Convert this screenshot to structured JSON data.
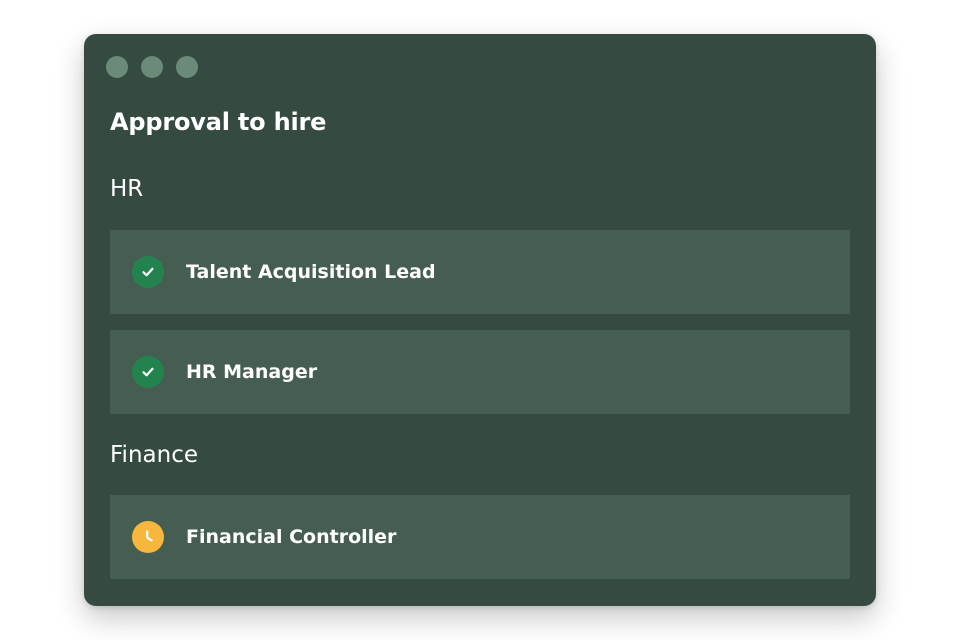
{
  "window": {
    "title": "Approval to hire"
  },
  "sections": [
    {
      "label": "HR",
      "items": [
        {
          "label": "Talent Acquisition Lead",
          "status": "approved",
          "icon": "check-circle-icon"
        },
        {
          "label": "HR Manager",
          "status": "approved",
          "icon": "check-circle-icon"
        }
      ]
    },
    {
      "label": "Finance",
      "items": [
        {
          "label": "Financial Controller",
          "status": "pending",
          "icon": "clock-icon"
        }
      ]
    }
  ],
  "colors": {
    "window_bg": "#354a40",
    "row_bg": "#465e52",
    "approved": "#22834f",
    "pending": "#f6b73c",
    "window_dots": "#6b8a7a"
  }
}
